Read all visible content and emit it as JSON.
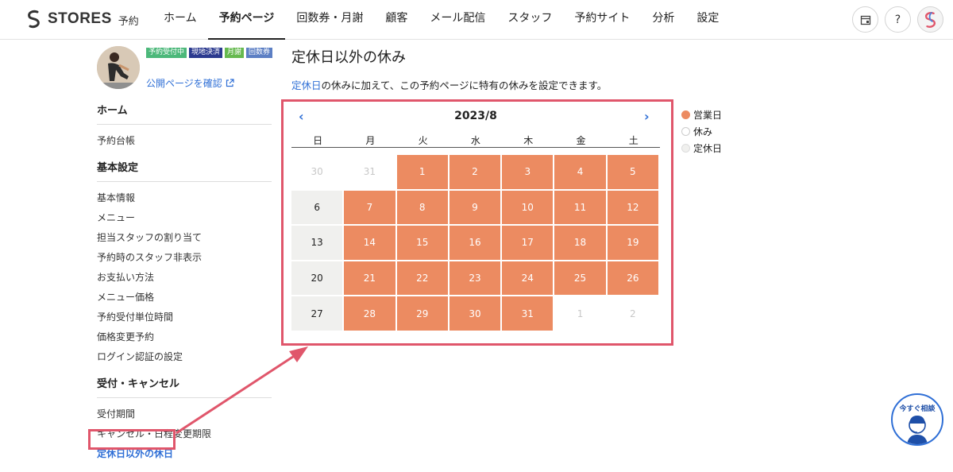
{
  "brand": {
    "name": "STORES",
    "sub": "予約"
  },
  "nav": {
    "items": [
      {
        "label": "ホーム",
        "active": false
      },
      {
        "label": "予約ページ",
        "active": true
      },
      {
        "label": "回数券・月謝",
        "active": false
      },
      {
        "label": "顧客",
        "active": false
      },
      {
        "label": "メール配信",
        "active": false
      },
      {
        "label": "スタッフ",
        "active": false
      },
      {
        "label": "予約サイト",
        "active": false
      },
      {
        "label": "分析",
        "active": false
      },
      {
        "label": "設定",
        "active": false
      }
    ],
    "help": "?"
  },
  "sidebar": {
    "badges": [
      {
        "label": "予約受付中",
        "color": "#4cb87a"
      },
      {
        "label": "現地決済",
        "color": "#2b3a8f"
      },
      {
        "label": "月謝",
        "color": "#66b94f"
      },
      {
        "label": "回数券",
        "color": "#5c7fc4"
      }
    ],
    "public_link": "公開ページを確認",
    "sections": [
      {
        "title": "ホーム",
        "items": [
          "予約台帳"
        ]
      },
      {
        "title": "基本設定",
        "items": [
          "基本情報",
          "メニュー",
          "担当スタッフの割り当て",
          "予約時のスタッフ非表示",
          "お支払い方法",
          "メニュー価格",
          "予約受付単位時間",
          "価格変更予約",
          "ログイン認証の設定"
        ]
      },
      {
        "title": "受付・キャンセル",
        "items": [
          "受付期間",
          "キャンセル・日程変更期限",
          "定休日以外の休日"
        ]
      }
    ],
    "current_item": "定休日以外の休日"
  },
  "main": {
    "title": "定休日以外の休み",
    "desc_link": "定休日",
    "desc_rest": "の休みに加えて、この予約ページに特有の休みを設定できます。"
  },
  "calendar": {
    "month": "2023/8",
    "weekdays": [
      "日",
      "月",
      "火",
      "水",
      "木",
      "金",
      "土"
    ],
    "weeks": [
      [
        {
          "d": "30",
          "s": "out"
        },
        {
          "d": "31",
          "s": "out"
        },
        {
          "d": "1",
          "s": "open"
        },
        {
          "d": "2",
          "s": "open"
        },
        {
          "d": "3",
          "s": "open"
        },
        {
          "d": "4",
          "s": "open"
        },
        {
          "d": "5",
          "s": "open"
        }
      ],
      [
        {
          "d": "6",
          "s": "regular"
        },
        {
          "d": "7",
          "s": "open"
        },
        {
          "d": "8",
          "s": "open"
        },
        {
          "d": "9",
          "s": "open"
        },
        {
          "d": "10",
          "s": "open"
        },
        {
          "d": "11",
          "s": "open"
        },
        {
          "d": "12",
          "s": "open"
        }
      ],
      [
        {
          "d": "13",
          "s": "regular"
        },
        {
          "d": "14",
          "s": "open"
        },
        {
          "d": "15",
          "s": "open"
        },
        {
          "d": "16",
          "s": "open"
        },
        {
          "d": "17",
          "s": "open"
        },
        {
          "d": "18",
          "s": "open"
        },
        {
          "d": "19",
          "s": "open"
        }
      ],
      [
        {
          "d": "20",
          "s": "regular"
        },
        {
          "d": "21",
          "s": "open"
        },
        {
          "d": "22",
          "s": "open"
        },
        {
          "d": "23",
          "s": "open"
        },
        {
          "d": "24",
          "s": "open"
        },
        {
          "d": "25",
          "s": "open"
        },
        {
          "d": "26",
          "s": "open"
        }
      ],
      [
        {
          "d": "27",
          "s": "regular"
        },
        {
          "d": "28",
          "s": "open"
        },
        {
          "d": "29",
          "s": "open"
        },
        {
          "d": "30",
          "s": "open"
        },
        {
          "d": "31",
          "s": "open"
        },
        {
          "d": "1",
          "s": "out"
        },
        {
          "d": "2",
          "s": "out"
        }
      ]
    ]
  },
  "legend": [
    {
      "label": "営業日",
      "color": "#ec8b61",
      "border": "#ec8b61"
    },
    {
      "label": "休み",
      "color": "#ffffff",
      "border": "#cccccc"
    },
    {
      "label": "定休日",
      "color": "#f0f0ee",
      "border": "#dddddd"
    }
  ],
  "chat": {
    "label": "今すぐ相談"
  },
  "colors": {
    "accent": "#2f6fd6",
    "open_day": "#ec8b61",
    "annotation": "#e0566b"
  }
}
